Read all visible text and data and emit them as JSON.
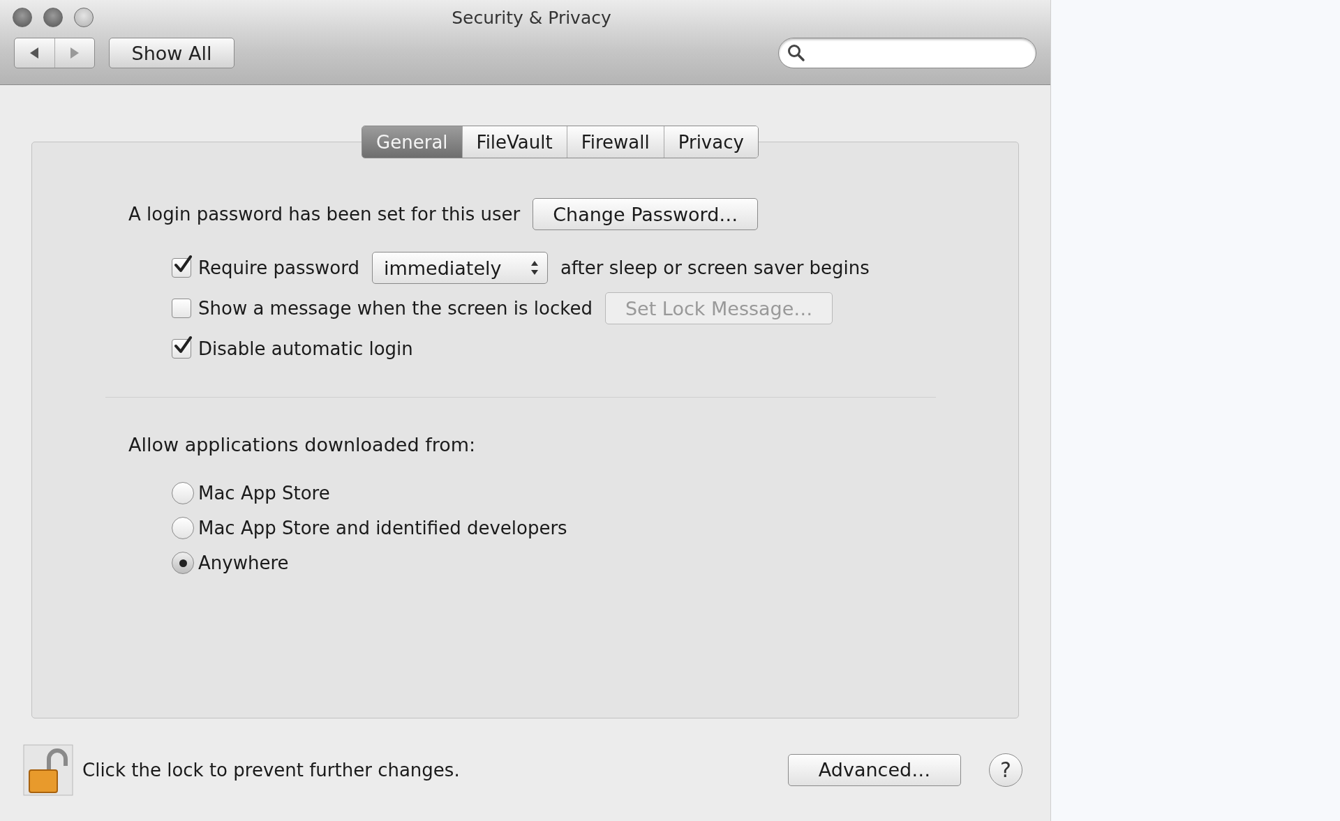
{
  "window": {
    "title": "Security & Privacy"
  },
  "toolbar": {
    "show_all": "Show All"
  },
  "tabs": [
    {
      "label": "General",
      "selected": true
    },
    {
      "label": "FileVault",
      "selected": false
    },
    {
      "label": "Firewall",
      "selected": false
    },
    {
      "label": "Privacy",
      "selected": false
    }
  ],
  "general": {
    "password_text": "A login password has been set for this user",
    "change_password": "Change Password…",
    "options": [
      {
        "kind": "select",
        "label": "Require password",
        "checked": true,
        "value": "immediately",
        "suffix": "after sleep or screen saver begins"
      },
      {
        "kind": "button",
        "label": "Show a message when the screen is locked",
        "checked": false,
        "button": {
          "label": "Set Lock Message…",
          "disabled": true
        }
      },
      {
        "kind": "plain",
        "label": "Disable automatic login",
        "checked": true
      }
    ]
  },
  "downloads": {
    "heading": "Allow applications downloaded from:",
    "options": [
      {
        "label": "Mac App Store",
        "selected": false
      },
      {
        "label": "Mac App Store and identified developers",
        "selected": false
      },
      {
        "label": "Anywhere",
        "selected": true
      }
    ]
  },
  "footer": {
    "locked": false,
    "lock_text": "Click the lock to prevent further changes.",
    "advanced": "Advanced…",
    "help": "?"
  }
}
